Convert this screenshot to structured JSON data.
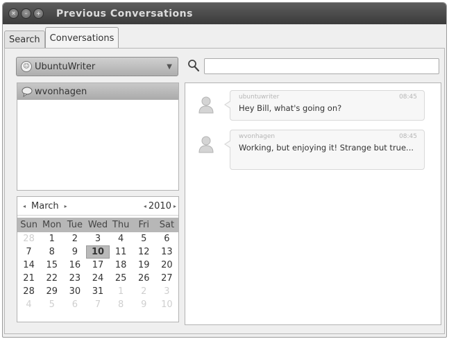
{
  "window": {
    "title": "Previous Conversations",
    "buttons": [
      {
        "name": "close-button",
        "glyph": "✕"
      },
      {
        "name": "minimize-button",
        "glyph": "–"
      },
      {
        "name": "maximize-button",
        "glyph": "+"
      }
    ]
  },
  "tabs": [
    {
      "label": "Search",
      "active": false
    },
    {
      "label": "Conversations",
      "active": true
    }
  ],
  "account": {
    "selected": "UbuntuWriter",
    "icon": "account-icon"
  },
  "search": {
    "placeholder": "",
    "value": ""
  },
  "contacts": [
    {
      "name": "wvonhagen",
      "selected": true
    }
  ],
  "calendar": {
    "month": "March",
    "year": "2010",
    "prev_arrow": "◂",
    "next_arrow": "▸",
    "weekdays": [
      "Sun",
      "Mon",
      "Tue",
      "Wed",
      "Thu",
      "Fri",
      "Sat"
    ],
    "weeks": [
      [
        "28",
        "1",
        "2",
        "3",
        "4",
        "5",
        "6"
      ],
      [
        "7",
        "8",
        "9",
        "10",
        "11",
        "12",
        "13"
      ],
      [
        "14",
        "15",
        "16",
        "17",
        "18",
        "19",
        "20"
      ],
      [
        "21",
        "22",
        "23",
        "24",
        "25",
        "26",
        "27"
      ],
      [
        "28",
        "29",
        "30",
        "31",
        "1",
        "2",
        "3"
      ],
      [
        "4",
        "5",
        "6",
        "7",
        "8",
        "9",
        "10"
      ]
    ],
    "selected_day": "10"
  },
  "messages": [
    {
      "sender": "ubuntuwriter",
      "time": "08:45",
      "text": "Hey Bill, what's going on?"
    },
    {
      "sender": "wvonhagen",
      "time": "08:45",
      "text": "Working, but enjoying it! Strange but true..."
    }
  ]
}
